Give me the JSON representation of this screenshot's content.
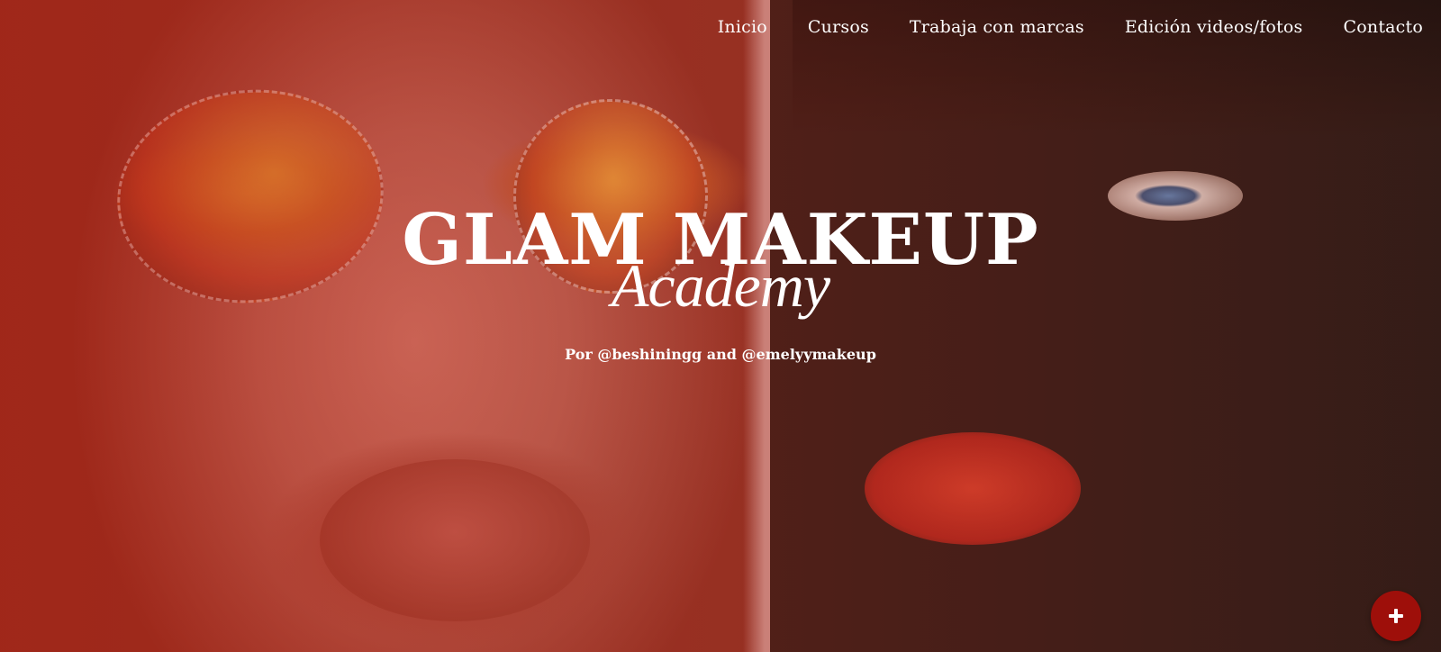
{
  "nav": {
    "items": [
      {
        "label": "Inicio"
      },
      {
        "label": "Cursos"
      },
      {
        "label": "Trabaja con marcas"
      },
      {
        "label": "Edición videos/fotos"
      },
      {
        "label": "Contacto"
      }
    ]
  },
  "hero": {
    "title": "GLAM MAKEUP",
    "script_title": "Academy",
    "subtitle": "Por @beshiningg and @emelyymakeup"
  },
  "fab": {
    "icon": "plus-icon",
    "color": "#9e0f0a"
  }
}
